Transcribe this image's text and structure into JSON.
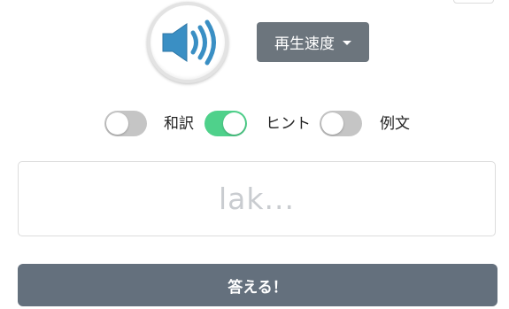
{
  "speaker": {
    "icon": "speaker-volume-icon"
  },
  "speed_dropdown": {
    "label": "再生速度",
    "icon": "caret-down-icon"
  },
  "toggles": [
    {
      "label": "和訳",
      "checked": false
    },
    {
      "label": "ヒント",
      "checked": true
    },
    {
      "label": "例文",
      "checked": false
    }
  ],
  "answer": {
    "placeholder": "lak...",
    "value": ""
  },
  "submit": {
    "label": "答える！"
  },
  "colors": {
    "toggle_on": "#4fd18b",
    "toggle_off": "#c5c5c5",
    "dropdown_bg": "#6c757d",
    "submit_bg": "#64707d",
    "speaker_blue": "#3a8fc4"
  }
}
